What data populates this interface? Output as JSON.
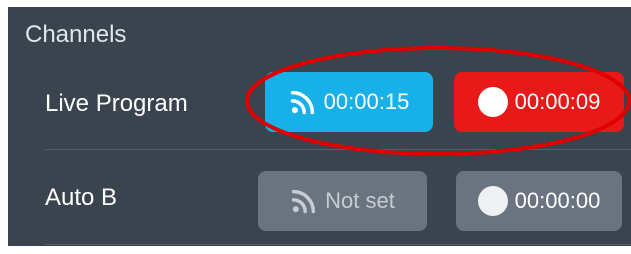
{
  "channels": {
    "title": "Channels",
    "rows": [
      {
        "label": "Live Program",
        "feed": {
          "icon": "rss-feed-icon",
          "text": "00:00:15",
          "color": "#17b0e9"
        },
        "record": {
          "icon": "record-dot-icon",
          "text": "00:00:09",
          "color": "#e81919"
        }
      },
      {
        "label": "Auto B",
        "feed": {
          "icon": "rss-feed-icon",
          "text": "Not set",
          "color": "#697480"
        },
        "record": {
          "icon": "record-dot-icon",
          "text": "00:00:00",
          "color": "#697480"
        }
      }
    ]
  },
  "annotation": {
    "color": "#e00000"
  }
}
